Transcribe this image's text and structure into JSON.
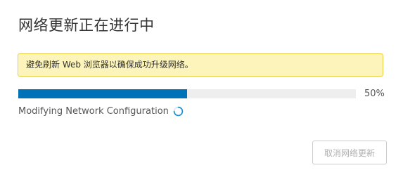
{
  "dialog": {
    "title": "网络更新正在进行中",
    "warning_message": "避免刷新 Web 浏览器以确保成功升级网络。",
    "progress": {
      "value_percent": 50,
      "label": "50%",
      "color": "#0072b8"
    },
    "status_text": "Modifying Network Configuration",
    "status_icon": "spinner-icon",
    "cancel_button_label": "取消网络更新",
    "cancel_button_disabled": true
  }
}
